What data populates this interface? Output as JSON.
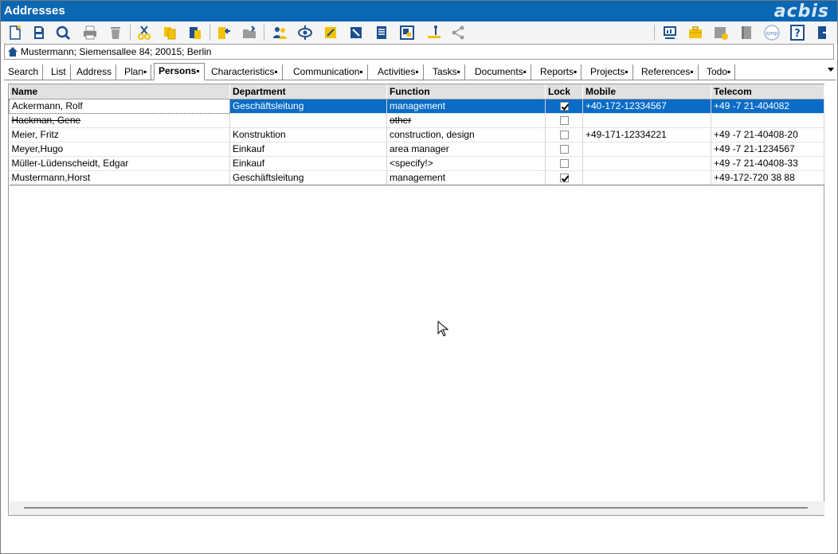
{
  "window": {
    "title": "Addresses",
    "logo_text": "acbis"
  },
  "toolbar": {
    "left_icons": [
      "new-icon",
      "save-icon",
      "search-icon",
      "print-icon",
      "delete-icon",
      "cut-icon",
      "copy-icon",
      "paste-icon",
      "import-icon",
      "open-folder-icon",
      "contacts-icon",
      "view-icon",
      "edit-icon",
      "tools-icon",
      "document-icon",
      "layout-icon",
      "ruler-icon",
      "share-icon"
    ],
    "right_icons": [
      "monitor-icon",
      "briefcase-icon",
      "folder-check-icon",
      "book-icon",
      "smp-icon",
      "help-icon",
      "exit-icon"
    ],
    "smp_label": "smp",
    "help_label": "?"
  },
  "addressbar": {
    "text": "Mustermann; Siemensallee 84; 20015; Berlin"
  },
  "tabs": [
    {
      "label": "Search"
    },
    {
      "label": "List"
    },
    {
      "label": "Address"
    },
    {
      "label": "Plan▪"
    },
    {
      "label": "Persons▪",
      "active": true
    },
    {
      "label": "Characteristics▪"
    },
    {
      "label": "Communication▪"
    },
    {
      "label": "Activities▪"
    },
    {
      "label": "Tasks▪"
    },
    {
      "label": "Documents▪"
    },
    {
      "label": "Reports▪"
    },
    {
      "label": "Projects▪"
    },
    {
      "label": "References▪"
    },
    {
      "label": "Todo▪"
    }
  ],
  "grid": {
    "columns": [
      "Name",
      "Department",
      "Function",
      "Lock",
      "Mobile",
      "Telecom"
    ],
    "rows": [
      {
        "name": "Ackermann, Rolf",
        "department": "Geschäftsleitung",
        "function": "management",
        "lock": true,
        "mobile": "+40-172-12334567",
        "telecom": "+49  -7 21-404082",
        "selected": true
      },
      {
        "name": "Hackman, Gene",
        "department": "",
        "function": "other",
        "lock": false,
        "mobile": "",
        "telecom": "",
        "strike": true
      },
      {
        "name": "Meier, Fritz",
        "department": "Konstruktion",
        "function": "construction, design",
        "lock": false,
        "mobile": "+49-171-12334221",
        "telecom": "+49  -7 21-40408-20"
      },
      {
        "name": "Meyer,Hugo",
        "department": "Einkauf",
        "function": "area manager",
        "lock": false,
        "mobile": "",
        "telecom": "+49  -7 21-1234567"
      },
      {
        "name": "Müller-Lüdenscheidt, Edgar",
        "department": "Einkauf",
        "function": "<specify!>",
        "lock": false,
        "mobile": "",
        "telecom": "+49  -7 21-40408-33"
      },
      {
        "name": "Mustermann,Horst",
        "department": "Geschäftsleitung",
        "function": "management",
        "lock": true,
        "mobile": "",
        "telecom": "+49-172-720 38 88"
      }
    ]
  },
  "colors": {
    "title_bg": "#0a67b4",
    "selection": "#0a6cc6",
    "icon_blue": "#1c4f8f",
    "icon_yellow": "#f2c200"
  }
}
